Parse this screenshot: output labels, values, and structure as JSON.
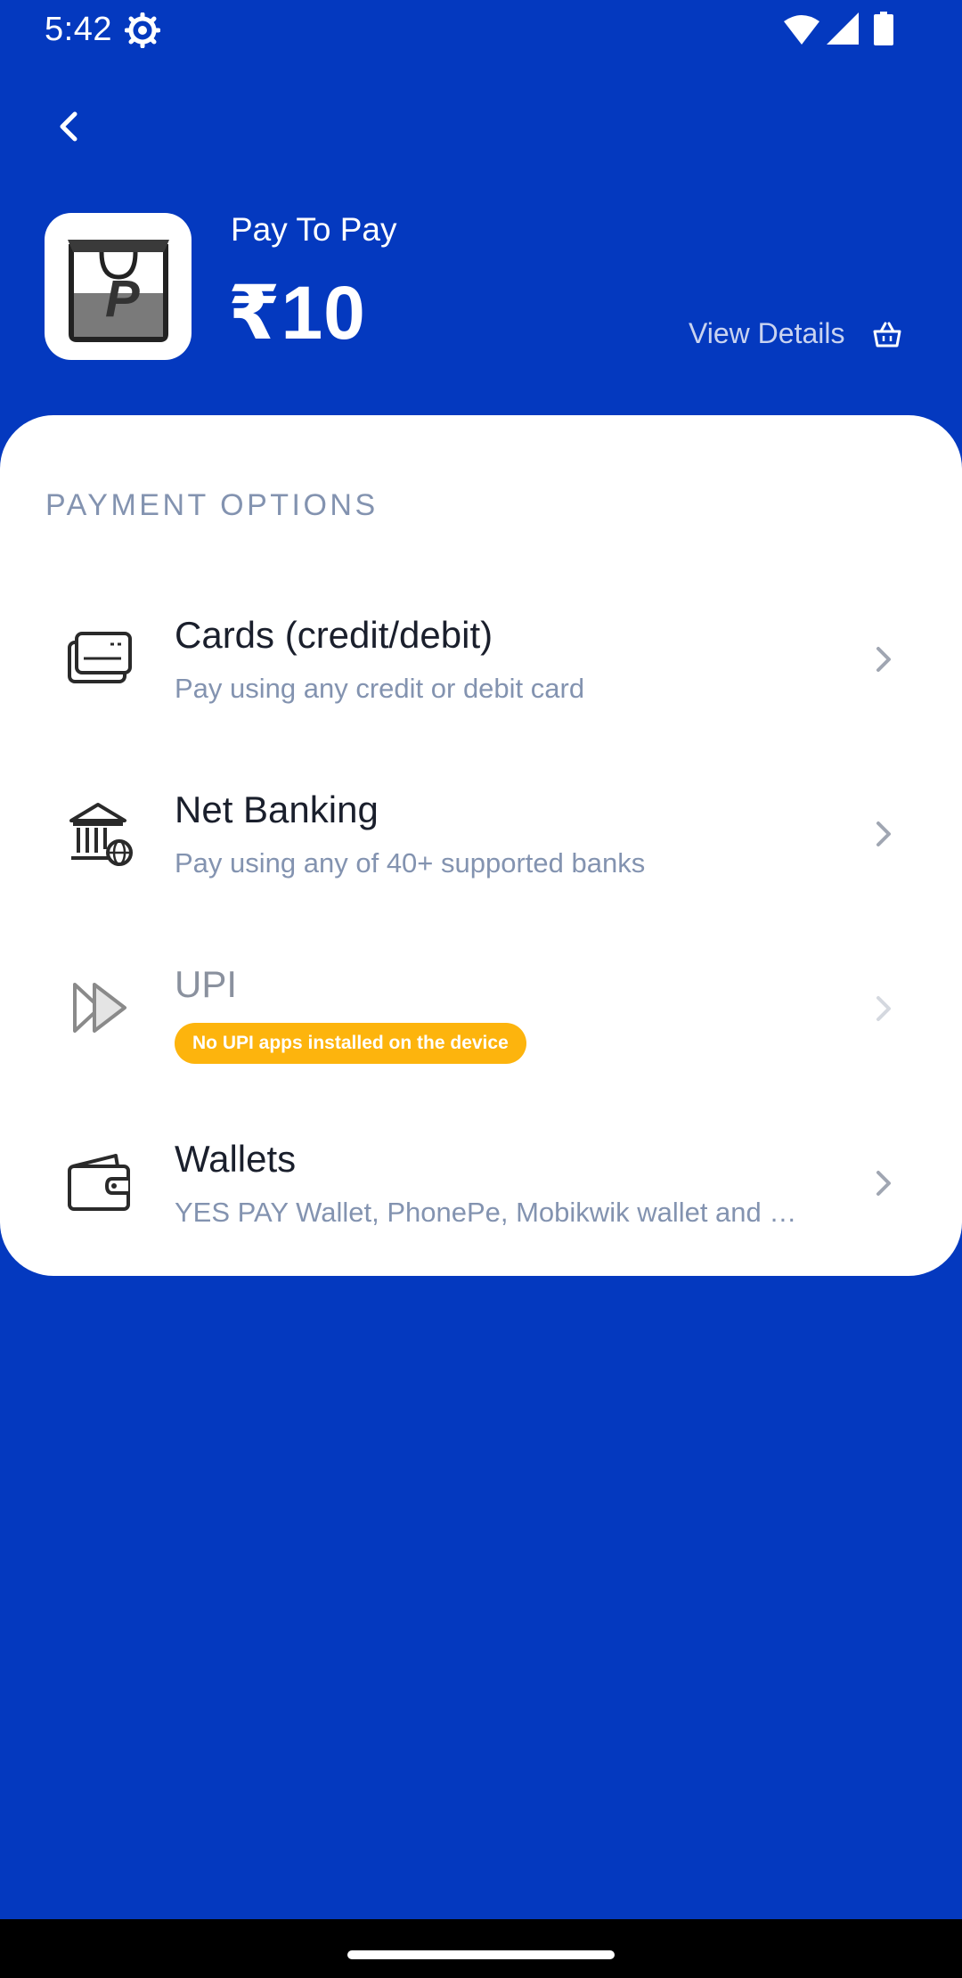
{
  "status_bar": {
    "time": "5:42",
    "icons": [
      "settings-gear-icon",
      "wifi-icon",
      "cellular-signal-icon",
      "battery-icon"
    ]
  },
  "header": {
    "back_icon": "chevron-left-icon",
    "merchant_name": "Pay To Pay",
    "amount": "₹10",
    "view_details_label": "View Details",
    "view_details_icon": "shopping-basket-icon"
  },
  "payment_options": {
    "section_title": "PAYMENT OPTIONS",
    "items": [
      {
        "title": "Cards (credit/debit)",
        "subtitle": "Pay using any credit or debit card",
        "icon": "credit-card-icon",
        "enabled": true
      },
      {
        "title": "Net Banking",
        "subtitle": "Pay using any of 40+ supported banks",
        "icon": "bank-icon",
        "enabled": true
      },
      {
        "title": "UPI",
        "badge": "No UPI apps installed on the device",
        "icon": "upi-arrows-icon",
        "enabled": false
      },
      {
        "title": "Wallets",
        "subtitle": "YES PAY Wallet, PhonePe, Mobikwik wallet and more",
        "icon": "wallet-icon",
        "enabled": true
      }
    ]
  },
  "colors": {
    "brand_blue": "#0439BF",
    "badge_orange": "#FDB40D",
    "text_muted": "#8393B0",
    "text_dark": "#1A1F2C"
  }
}
